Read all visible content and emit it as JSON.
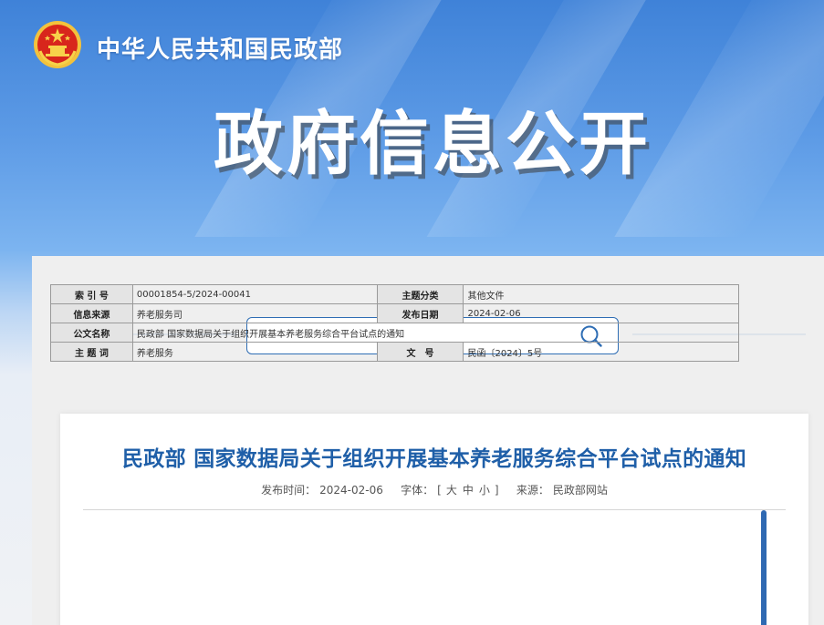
{
  "header": {
    "ministry_name": "中华人民共和国民政部",
    "banner_title": "政府信息公开"
  },
  "search": {
    "value": "",
    "placeholder": ""
  },
  "article": {
    "title": "民政部 国家数据局关于组织开展基本养老服务综合平台试点的通知",
    "meta": {
      "publish_label": "发布时间：",
      "publish_date": "2024-02-06",
      "font_label": "字体：",
      "font_open": "[",
      "font_large": "大",
      "font_medium": "中",
      "font_small": "小",
      "font_close": "]",
      "source_label": "来源：",
      "source": "民政部网站"
    },
    "info_table": {
      "index_label": "索 引 号",
      "index_value": "00001854-5/2024-00041",
      "category_label": "主题分类",
      "category_value": "其他文件",
      "origin_label": "信息来源",
      "origin_value": "养老服务司",
      "date_label": "发布日期",
      "date_value": "2024-02-06",
      "doc_name_label": "公文名称",
      "doc_name_value": "民政部 国家数据局关于组织开展基本养老服务综合平台试点的通知",
      "subject_label": "主 题 词",
      "subject_value": "养老服务",
      "doc_no_label": "文　号",
      "doc_no_value": "民函〔2024〕5号"
    }
  },
  "colors": {
    "accent": "#1f5fa8",
    "border": "#2e6db4",
    "scrollbar": "#2f69b2"
  },
  "icons": {
    "emblem": "national-emblem-icon",
    "search": "search-icon"
  }
}
